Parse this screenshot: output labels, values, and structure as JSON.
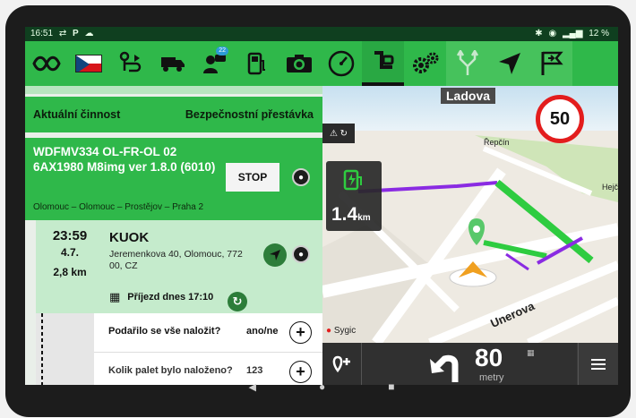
{
  "status_bar": {
    "time": "16:51",
    "left_icons": [
      "tethering-icon",
      "parking-icon",
      "cloud-upload-icon"
    ],
    "battery": "12 %"
  },
  "toolbar": {
    "icons": [
      "route-icon",
      "czech-flag-icon",
      "route-map-icon",
      "truck-icon",
      "messages-icon",
      "fuel-icon",
      "camera-icon",
      "speedometer-icon",
      "tachograph-icon",
      "settings-gears-icon",
      "merge-arrows-icon",
      "navigate-arrow-icon",
      "flag-end-icon"
    ],
    "messages_badge": "22",
    "active_index": 8
  },
  "panel": {
    "header_left": "Aktuální činnost",
    "header_right": "Bezpečnostní přestávka",
    "trip_title": "WDFMV334 OL-FR-OL 02 6AX1980 M8img ver 1.8.0 (6010)",
    "trip_route": "Olomouc – Olomouc – Prostějov – Praha 2",
    "stop_label": "STOP"
  },
  "task": {
    "time": "23:59",
    "date": "4.7.",
    "distance": "2,8 km",
    "name": "KUOK",
    "address": "Jeremenkova 40, Olomouc, 772 00, CZ",
    "arrival": "Příjezd dnes 17:10"
  },
  "questions": [
    {
      "text": "Podařilo se vše naložit?",
      "answer": "ano/ne"
    },
    {
      "text": "Kolik palet bylo naloženo?",
      "answer": "123"
    }
  ],
  "map": {
    "street_name_top": "Ladova",
    "speed_limit": "50",
    "poi_distance": "1.4",
    "poi_unit": "km",
    "city_label": "Řepčín",
    "edge_label": "Hejč",
    "street_name_rotated": "Unerova",
    "brand": "Sygic"
  },
  "nav_bar": {
    "distance": "80",
    "unit": "metry"
  },
  "colors": {
    "brand_green": "#2fb84a",
    "route_purple": "#8a2be2",
    "route_green": "#2ecc40",
    "speed_red": "#e31d1d"
  }
}
